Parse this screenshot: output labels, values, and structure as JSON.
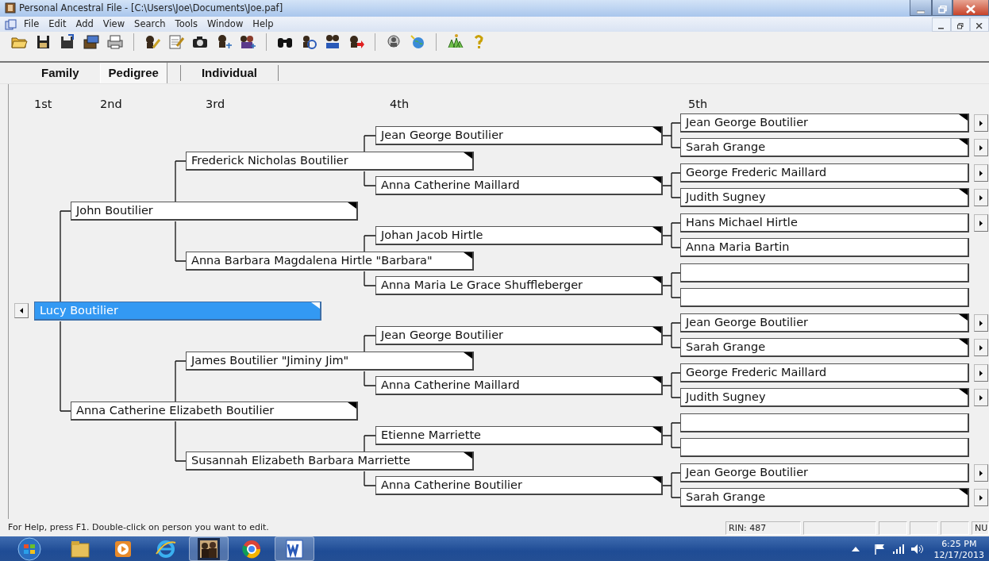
{
  "window": {
    "title": "Personal Ancestral File - [C:\\Users\\Joe\\Documents\\Joe.paf]"
  },
  "menu": [
    "File",
    "Edit",
    "Add",
    "View",
    "Search",
    "Tools",
    "Window",
    "Help"
  ],
  "tabs": [
    {
      "label": "Family",
      "selected": false
    },
    {
      "label": "Pedigree",
      "selected": true
    },
    {
      "label": "Individual",
      "selected": false
    }
  ],
  "pedigree": {
    "generations": [
      "1st",
      "2nd",
      "3rd",
      "4th",
      "5th"
    ],
    "root": {
      "kind": "person",
      "name": "Lucy Boutilier",
      "selected": true,
      "marked": true,
      "parents": [
        {
          "kind": "person",
          "name": "John Boutilier",
          "selected": false,
          "marked": true,
          "parents": [
            {
              "kind": "person",
              "name": "Frederick Nicholas Boutilier",
              "selected": false,
              "marked": true,
              "parents": [
                {
                  "kind": "person",
                  "name": "Jean George Boutilier",
                  "selected": false,
                  "marked": true,
                  "parents": [
                    {
                      "kind": "person",
                      "name": "Jean George Boutilier",
                      "selected": false,
                      "marked": true,
                      "expandable": true
                    },
                    {
                      "kind": "person",
                      "name": "Sarah Grange",
                      "selected": false,
                      "marked": true,
                      "expandable": true
                    }
                  ]
                },
                {
                  "kind": "person",
                  "name": "Anna Catherine Maillard",
                  "selected": false,
                  "marked": true,
                  "parents": [
                    {
                      "kind": "person",
                      "name": "George Frederic Maillard",
                      "selected": false,
                      "marked": false,
                      "expandable": true
                    },
                    {
                      "kind": "person",
                      "name": "Judith Sugney",
                      "selected": false,
                      "marked": true,
                      "expandable": true
                    }
                  ]
                }
              ]
            },
            {
              "kind": "person",
              "name": "Anna Barbara Magdalena Hirtle \"Barbara\"",
              "selected": false,
              "marked": true,
              "parents": [
                {
                  "kind": "person",
                  "name": "Johan Jacob Hirtle",
                  "selected": false,
                  "marked": true,
                  "parents": [
                    {
                      "kind": "person",
                      "name": "Hans Michael Hirtle",
                      "selected": false,
                      "marked": false,
                      "expandable": true
                    },
                    {
                      "kind": "person",
                      "name": "Anna Maria Bartin",
                      "selected": false,
                      "marked": false,
                      "expandable": false
                    }
                  ]
                },
                {
                  "kind": "person",
                  "name": "Anna Maria Le Grace Shuffleberger",
                  "selected": false,
                  "marked": true,
                  "parents": [
                    {
                      "kind": "empty",
                      "selected": false,
                      "expandable": false
                    },
                    {
                      "kind": "empty",
                      "selected": false,
                      "expandable": false
                    }
                  ]
                }
              ]
            }
          ]
        },
        {
          "kind": "person",
          "name": "Anna Catherine Elizabeth Boutilier",
          "selected": false,
          "marked": true,
          "parents": [
            {
              "kind": "person",
              "name": "James Boutilier \"Jiminy Jim\"",
              "selected": false,
              "marked": true,
              "parents": [
                {
                  "kind": "person",
                  "name": "Jean George Boutilier",
                  "selected": false,
                  "marked": true,
                  "parents": [
                    {
                      "kind": "person",
                      "name": "Jean George Boutilier",
                      "selected": false,
                      "marked": true,
                      "expandable": true
                    },
                    {
                      "kind": "person",
                      "name": "Sarah Grange",
                      "selected": false,
                      "marked": true,
                      "expandable": true
                    }
                  ]
                },
                {
                  "kind": "person",
                  "name": "Anna Catherine Maillard",
                  "selected": false,
                  "marked": true,
                  "parents": [
                    {
                      "kind": "person",
                      "name": "George Frederic Maillard",
                      "selected": false,
                      "marked": false,
                      "expandable": true
                    },
                    {
                      "kind": "person",
                      "name": "Judith Sugney",
                      "selected": false,
                      "marked": true,
                      "expandable": true
                    }
                  ]
                }
              ]
            },
            {
              "kind": "person",
              "name": "Susannah Elizabeth Barbara Marriette",
              "selected": false,
              "marked": true,
              "parents": [
                {
                  "kind": "person",
                  "name": "Etienne Marriette",
                  "selected": false,
                  "marked": true,
                  "parents": [
                    {
                      "kind": "empty",
                      "selected": false,
                      "expandable": false
                    },
                    {
                      "kind": "empty",
                      "selected": false,
                      "expandable": false
                    }
                  ]
                },
                {
                  "kind": "person",
                  "name": "Anna Catherine Boutilier",
                  "selected": false,
                  "marked": true,
                  "parents": [
                    {
                      "kind": "person",
                      "name": "Jean George Boutilier",
                      "selected": false,
                      "marked": false,
                      "expandable": true
                    },
                    {
                      "kind": "person",
                      "name": "Sarah Grange",
                      "selected": false,
                      "marked": true,
                      "expandable": true
                    }
                  ]
                }
              ]
            }
          ]
        }
      ]
    }
  },
  "status_bar": {
    "help": "For Help, press F1. Double-click on person you want to edit.",
    "record": "RIN: 487",
    "keys": "NU"
  },
  "taskbar": {
    "time": "6:25 PM",
    "date": "12/17/2013"
  }
}
